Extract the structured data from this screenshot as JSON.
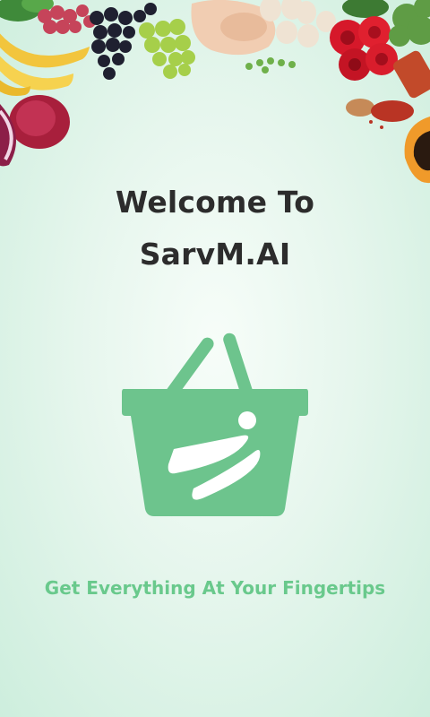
{
  "welcome": {
    "line1": "Welcome To",
    "line2": "SarvM.AI"
  },
  "tagline": "Get Everything At Your Fingertips",
  "colors": {
    "brand": "#6dc48d",
    "title_text": "#2c2c2c",
    "tagline_text": "#69c98c"
  }
}
